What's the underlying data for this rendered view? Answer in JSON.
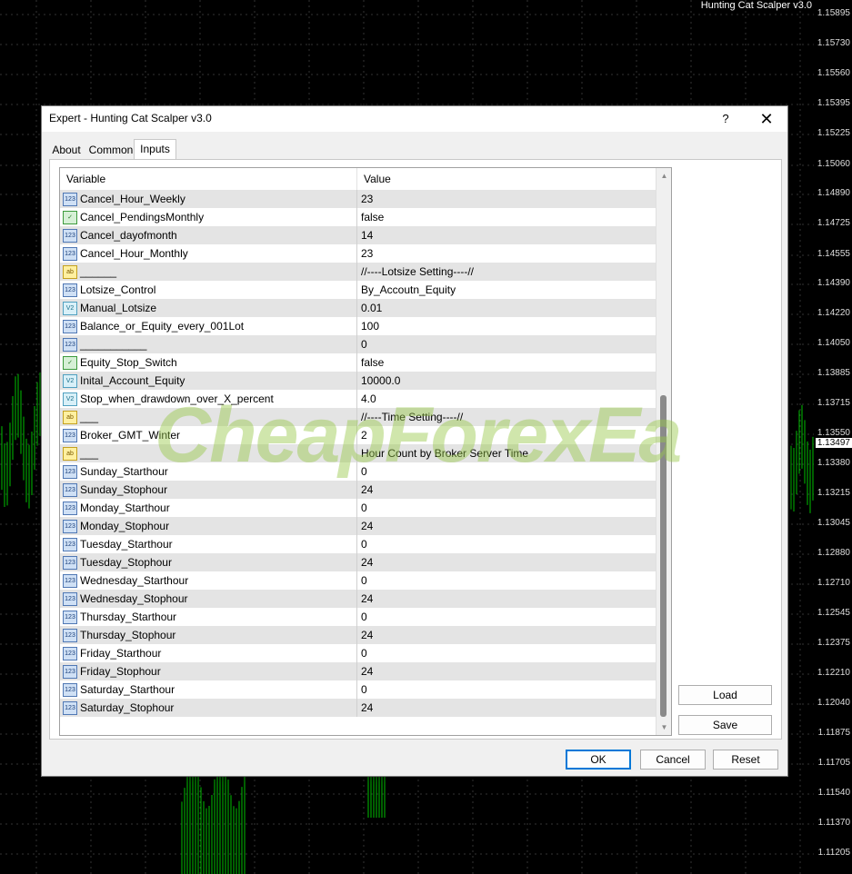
{
  "chart": {
    "title": "Hunting Cat Scalper v3.0",
    "prices": [
      "1.15895",
      "1.15730",
      "1.15560",
      "1.15395",
      "1.15225",
      "1.15060",
      "1.14890",
      "1.14725",
      "1.14555",
      "1.14390",
      "1.14220",
      "1.14050",
      "1.13885",
      "1.13715",
      "1.13550",
      "1.13497",
      "1.13380",
      "1.13215",
      "1.13045",
      "1.12880",
      "1.12710",
      "1.12545",
      "1.12375",
      "1.12210",
      "1.12040",
      "1.11875",
      "1.11705",
      "1.11540",
      "1.11370",
      "1.11205"
    ],
    "current_price": "1.13497",
    "colors": {
      "bg": "#000000",
      "candle": "#00c000"
    }
  },
  "dialog": {
    "title": "Expert - Hunting Cat Scalper v3.0",
    "help": "?",
    "close": "✕",
    "tabs": [
      "About",
      "Common",
      "Inputs"
    ],
    "active_tab": "Inputs",
    "columns": {
      "variable": "Variable",
      "value": "Value"
    },
    "rows": [
      {
        "icon": "123",
        "name": "Cancel_Hour_Weekly",
        "value": "23"
      },
      {
        "icon": "bool",
        "name": "Cancel_PendingsMonthly",
        "value": "false"
      },
      {
        "icon": "123",
        "name": "Cancel_dayofmonth",
        "value": "14"
      },
      {
        "icon": "123",
        "name": "Cancel_Hour_Monthly",
        "value": "23"
      },
      {
        "icon": "ab",
        "name": "______",
        "value": "//----Lotsize Setting----//"
      },
      {
        "icon": "123",
        "name": "Lotsize_Control",
        "value": "By_Accoutn_Equity"
      },
      {
        "icon": "v2",
        "name": "Manual_Lotsize",
        "value": "0.01"
      },
      {
        "icon": "123",
        "name": "Balance_or_Equity_every_001Lot",
        "value": "100"
      },
      {
        "icon": "123",
        "name": "___________",
        "value": "0"
      },
      {
        "icon": "bool",
        "name": "Equity_Stop_Switch",
        "value": "false"
      },
      {
        "icon": "v2",
        "name": "Inital_Account_Equity",
        "value": "10000.0"
      },
      {
        "icon": "v2",
        "name": "Stop_when_drawdown_over_X_percent",
        "value": "4.0"
      },
      {
        "icon": "ab",
        "name": "___",
        "value": "//----Time Setting----//"
      },
      {
        "icon": "123",
        "name": "Broker_GMT_Winter",
        "value": "2"
      },
      {
        "icon": "ab",
        "name": "___",
        "value": "Hour Count by Broker Server Time"
      },
      {
        "icon": "123",
        "name": "Sunday_Starthour",
        "value": "0"
      },
      {
        "icon": "123",
        "name": "Sunday_Stophour",
        "value": "24"
      },
      {
        "icon": "123",
        "name": "Monday_Starthour",
        "value": "0"
      },
      {
        "icon": "123",
        "name": "Monday_Stophour",
        "value": "24"
      },
      {
        "icon": "123",
        "name": "Tuesday_Starthour",
        "value": "0"
      },
      {
        "icon": "123",
        "name": "Tuesday_Stophour",
        "value": "24"
      },
      {
        "icon": "123",
        "name": "Wednesday_Starthour",
        "value": "0"
      },
      {
        "icon": "123",
        "name": "Wednesday_Stophour",
        "value": "24"
      },
      {
        "icon": "123",
        "name": "Thursday_Starthour",
        "value": "0"
      },
      {
        "icon": "123",
        "name": "Thursday_Stophour",
        "value": "24"
      },
      {
        "icon": "123",
        "name": "Friday_Starthour",
        "value": "0"
      },
      {
        "icon": "123",
        "name": "Friday_Stophour",
        "value": "24"
      },
      {
        "icon": "123",
        "name": "Saturday_Starthour",
        "value": "0"
      },
      {
        "icon": "123",
        "name": "Saturday_Stophour",
        "value": "24"
      }
    ],
    "buttons": {
      "load": "Load",
      "save": "Save",
      "ok": "OK",
      "cancel": "Cancel",
      "reset": "Reset"
    }
  },
  "watermark": "CheapForexEa"
}
